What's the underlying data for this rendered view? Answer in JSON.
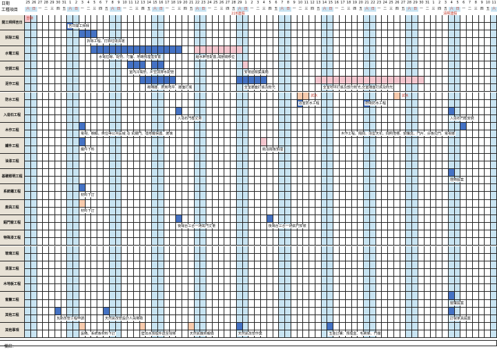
{
  "header": {
    "date_label": "日期",
    "item_label": "工種項目",
    "remarks_label": "備註:"
  },
  "dates": [
    "25",
    "26",
    "27",
    "28",
    "29",
    "30",
    "31",
    "1",
    "2",
    "3",
    "4",
    "5",
    "6",
    "7",
    "8",
    "9",
    "10",
    "11",
    "12",
    "13",
    "14",
    "15",
    "16",
    "17",
    "18",
    "19",
    "20",
    "21",
    "22",
    "23",
    "24",
    "25",
    "26",
    "27",
    "28",
    "29",
    "1",
    "2",
    "3",
    "4",
    "5",
    "6",
    "7",
    "8",
    "9",
    "10",
    "11",
    "12",
    "13",
    "14",
    "15",
    "16",
    "17",
    "18",
    "19",
    "20",
    "21",
    "22",
    "23",
    "24",
    "25",
    "26",
    "27",
    "28",
    "29",
    "30",
    "31",
    "1",
    "2",
    "3",
    "4",
    "5",
    "6",
    "7",
    "8",
    "9",
    "10",
    "11"
  ],
  "weekdays": [
    "六",
    "日",
    "一",
    "二",
    "三",
    "四",
    "五",
    "六",
    "日",
    "一",
    "二",
    "三",
    "四",
    "五",
    "六",
    "日",
    "一",
    "二",
    "三",
    "四",
    "五",
    "六",
    "日",
    "一",
    "二",
    "三",
    "四",
    "五",
    "六",
    "日",
    "一",
    "二",
    "三",
    "四",
    "五",
    "六",
    "日",
    "一",
    "二",
    "三",
    "四",
    "五",
    "六",
    "日",
    "一",
    "二",
    "三",
    "四",
    "五",
    "六",
    "日",
    "一",
    "二",
    "三",
    "四",
    "五",
    "六",
    "日",
    "一",
    "二",
    "三",
    "四",
    "五",
    "六",
    "日",
    "一",
    "二",
    "三",
    "四",
    "五",
    "六",
    "日",
    "一",
    "二",
    "三",
    "四",
    "五",
    "六"
  ],
  "holidays": [
    "228連假",
    "清明連假"
  ],
  "categories": [
    "開工拜拜吉日",
    "拆除工程",
    "水電工程",
    "空調工程",
    "泥作工程",
    "防水工程",
    "入造石工程",
    "木作工程",
    "鐵件工程",
    "油漆工程",
    "基礎照明工程",
    "系統櫃工程",
    "廚具工程",
    "鋁門窗工程",
    "特殊漆工程",
    "玻璃工程",
    "清潔工程",
    "木地板工程",
    "窗簾工程",
    "其他工程",
    "其他事項"
  ],
  "notes": {
    "test": "吉時",
    "kaigong": "吉日開工拜拜",
    "chaichu": "拆除工程、打除垃圾清運",
    "shuidian1": "水電拉線、配管、打鑿、地磚預埋盒安置",
    "shuidian2": "給水幹管配置,減壓閥移位",
    "kongtiao1": "室內冷風管、吊機",
    "kongtiao2": "空調排水配管",
    "kongtiao3": "安裝過樑集風箱",
    "nizuo1": "砌磚牆、廚房地坪、牆面打底",
    "nizuo2": "全室牆面打底及粉光",
    "nizuo3": "全室地坪打底及部分粉光,全室牆面打底及粉光",
    "fangshui_test1": "試水",
    "fangshui_test2": "試水",
    "fangshui1": "浴室防水工程",
    "fangshui2": "廚衛防水工程",
    "rzs1": "入造石門檻丈量",
    "rzs2": "入造石門檻安裝",
    "muzuo1": "電視、櫥櫃、車位等公共區域 及 玄關門、隱地鐵保護、玻璃",
    "muzuo2": "木作工程、隔間、造型天花、間照燈槽、窗簾盒、門片、白板拉門、電視牆",
    "tiejian1": "鐵件下料",
    "tiejian2": "衛浴隔板預埋",
    "jichu1": "燈飾提案",
    "xitong1": "材料下訂",
    "chuju1": "材料下訂",
    "lmc1": "後陽台三合一通氣門丈量",
    "lmc2": "後陽台三合一通氣門安裝",
    "chuanglian1": "窗簾提案",
    "qita1": "瓦斯改管工程申請",
    "qita2": "天然氣改管設計人員場勘",
    "qita3": "訂製家具提案",
    "shixiang1": "設備、系統板材料下訂",
    "shixiang2": "壁出水預埋件送至現場",
    "shixiang3": "天然氣廠商報價",
    "shixiang4": "天然氣改管作業",
    "shixiang5": "五金訂購：預埋盒、毛刷條、門擋"
  },
  "colors": {
    "blue": "#4472c4",
    "pink": "#f4c7cf",
    "peach": "#f8cbad",
    "lightblue": "#c8e4f2",
    "red": "#c0392b",
    "category_bg": "#e8e2d6"
  }
}
